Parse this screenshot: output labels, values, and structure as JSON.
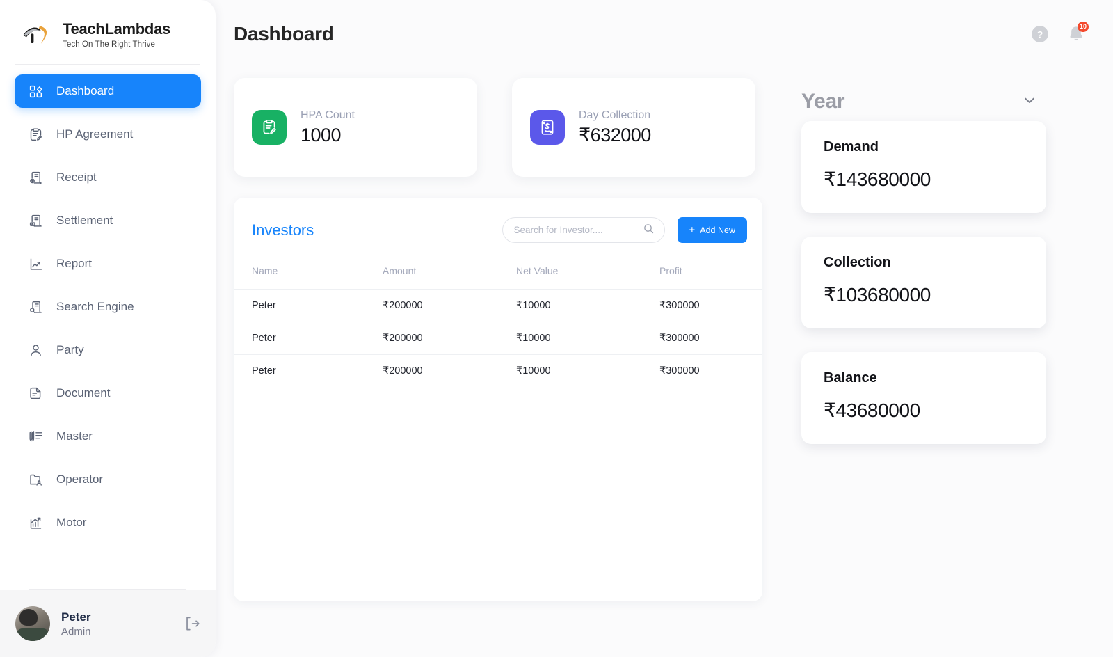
{
  "brand": {
    "name": "TeachLambdas",
    "tagline": "Tech On The Right Thrive"
  },
  "header": {
    "title": "Dashboard",
    "notification_count": "10"
  },
  "sidebar": {
    "items": [
      {
        "label": "Dashboard",
        "icon": "grid-icon",
        "active": true
      },
      {
        "label": "HP Agreement",
        "icon": "clipboard-edit-icon",
        "active": false
      },
      {
        "label": "Receipt",
        "icon": "receipt-add-icon",
        "active": false
      },
      {
        "label": "Settlement",
        "icon": "receipt-money-icon",
        "active": false
      },
      {
        "label": "Report",
        "icon": "trending-up-icon",
        "active": false
      },
      {
        "label": "Search Engine",
        "icon": "receipt-search-icon",
        "active": false
      },
      {
        "label": "Party",
        "icon": "user-icon",
        "active": false
      },
      {
        "label": "Document",
        "icon": "document-icon",
        "active": false
      },
      {
        "label": "Master",
        "icon": "clip-list-icon",
        "active": false
      },
      {
        "label": "Operator",
        "icon": "folder-user-icon",
        "active": false
      },
      {
        "label": "Motor",
        "icon": "bar-chart-up-icon",
        "active": false
      }
    ],
    "user": {
      "name": "Peter",
      "role": "Admin"
    }
  },
  "stats": [
    {
      "label": "HPA Count",
      "value": "1000",
      "icon": "clipboard-edit-icon",
      "color": "#18b164"
    },
    {
      "label": "Day Collection",
      "value": "₹632000",
      "icon": "money-hand-icon",
      "color": "#5b58ea"
    }
  ],
  "investors": {
    "title": "Investors",
    "search_placeholder": "Search for Investor....",
    "search_value": "",
    "add_label": "Add New",
    "columns": [
      "Name",
      "Amount",
      "Net Value",
      "Profit"
    ],
    "rows": [
      {
        "name": "Peter",
        "amount": "₹200000",
        "net_value": "₹10000",
        "profit": "₹300000"
      },
      {
        "name": "Peter",
        "amount": "₹200000",
        "net_value": "₹10000",
        "profit": "₹300000"
      },
      {
        "name": "Peter",
        "amount": "₹200000",
        "net_value": "₹10000",
        "profit": "₹300000"
      }
    ]
  },
  "summary": {
    "filter_label": "Year",
    "cards": [
      {
        "title": "Demand",
        "value": "₹143680000"
      },
      {
        "title": "Collection",
        "value": "₹103680000"
      },
      {
        "title": "Balance",
        "value": "₹43680000"
      }
    ]
  },
  "colors": {
    "accent": "#1784fb",
    "green": "#18b164",
    "purple": "#5b58ea",
    "badge": "#f4492d"
  }
}
